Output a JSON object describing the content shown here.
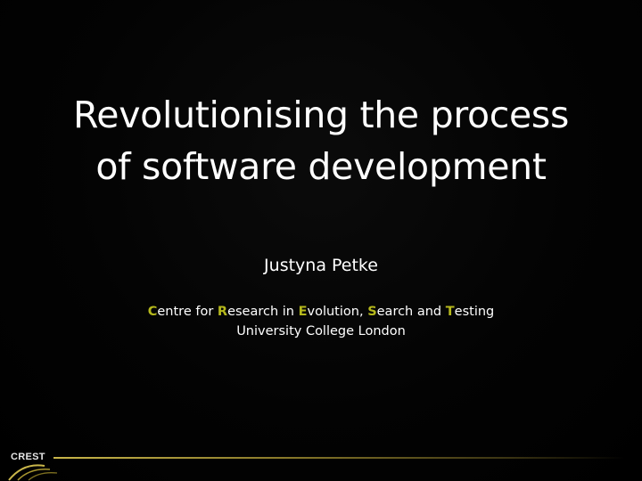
{
  "slide": {
    "title_lines": [
      "Revolutionising the process",
      "of software development"
    ],
    "author": "Justyna Petke",
    "affiliation": {
      "line1_parts": [
        {
          "text": "C",
          "highlight": true
        },
        {
          "text": "entre for ",
          "highlight": false
        },
        {
          "text": "R",
          "highlight": true
        },
        {
          "text": "esearch in ",
          "highlight": false
        },
        {
          "text": "E",
          "highlight": true
        },
        {
          "text": "volution, ",
          "highlight": false
        },
        {
          "text": "S",
          "highlight": true
        },
        {
          "text": "earch and ",
          "highlight": false
        },
        {
          "text": "T",
          "highlight": true
        },
        {
          "text": "esting",
          "highlight": false
        }
      ],
      "line2": "University College London"
    },
    "logo_text": "CREST"
  },
  "colors": {
    "background": "#000000",
    "text": "#ffffff",
    "accent": "#b5b81c",
    "footer_line": "#c9b64a"
  }
}
